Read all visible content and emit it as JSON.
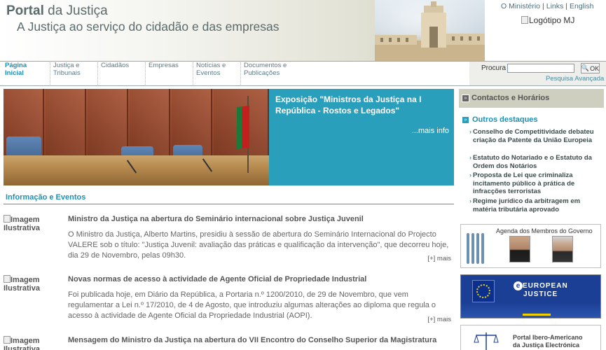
{
  "header": {
    "title_bold": "Portal",
    "title_rest": " da Justiça",
    "slogan": "A Justiça ao serviço do cidadão e das empresas",
    "top_links": [
      "O Ministério",
      "Links",
      "English"
    ],
    "logo_alt": "Logótipo MJ"
  },
  "nav": {
    "items": [
      {
        "line1": "Página",
        "line2": "Inicial",
        "active": true
      },
      {
        "line1": "Justiça e",
        "line2": "Tribunais",
        "active": false
      },
      {
        "line1": "Cidadãos",
        "line2": "",
        "active": false
      },
      {
        "line1": "Empresas",
        "line2": "",
        "active": false
      },
      {
        "line1": "Notícias e",
        "line2": "Eventos",
        "active": false
      },
      {
        "line1": "Documentos e",
        "line2": "Publicações",
        "active": false
      }
    ]
  },
  "search": {
    "label": "Procura",
    "value": "",
    "button": "OK",
    "advanced": "Pesquisa Avançada"
  },
  "feature": {
    "title": "Exposição \"Ministros da Justiça na I República - Rostos e Legados\"",
    "more": "...mais info"
  },
  "info": {
    "heading": "Informação e Eventos",
    "image_alt": "Imagem Ilustrativa",
    "more_label": "[+] mais",
    "items": [
      {
        "title": "Ministro da Justiça na abertura do Seminário internacional sobre Justiça Juvenil",
        "body": "O Ministro da Justiça, Alberto Martins, presidiu à sessão de abertura do Seminário Internacional do Projecto VALERE sob o título: \"Justiça Juvenil: avaliação das práticas e qualificação da intervenção\", que decorreu hoje, dia 29 de Novembro, pelas 09h30."
      },
      {
        "title": "Novas normas de acesso à actividade de Agente Oficial de Propriedade Industrial",
        "body": "Foi publicada hoje, em Diário da República, a Portaria n.º 1200/2010, de 29 de Novembro, que vem regulamentar a Lei n.º 17/2010, de 4 de Agosto, que introduziu algumas alterações ao diploma que regula o acesso à actividade de Agente Oficial da Propriedade Industrial (AOPI)."
      },
      {
        "title": "Mensagem do Ministro da Justiça na abertura do VII Encontro do Conselho Superior da Magistratura",
        "body": ""
      }
    ]
  },
  "sidebar": {
    "contacts": "Contactos e Horários",
    "highlights_title": "Outros destaques",
    "highlights": [
      "Conselho de Competitividade debateu criação da Patente da União Europeia",
      "Estatuto do Notariado e o Estatuto da Ordem dos Notários",
      "Proposta de Lei que criminaliza incitamento público à prática de infracções terroristas",
      "Regime jurídico da arbitragem em matéria tributária aprovado"
    ],
    "agenda_label": "Agenda dos Membros do Governo",
    "ej_line1": "EUROPEAN",
    "ej_line2": "JUSTICE",
    "ej_letter": "e",
    "ibero_line1": "Portal Ibero-Americano",
    "ibero_line2": "da Justiça Electrónica"
  },
  "colors": {
    "accent": "#2a9fbb",
    "nav_active": "#1f8fb3",
    "sidebar_header": "#cfcfbf",
    "ej_blue": "#1b3f95"
  }
}
